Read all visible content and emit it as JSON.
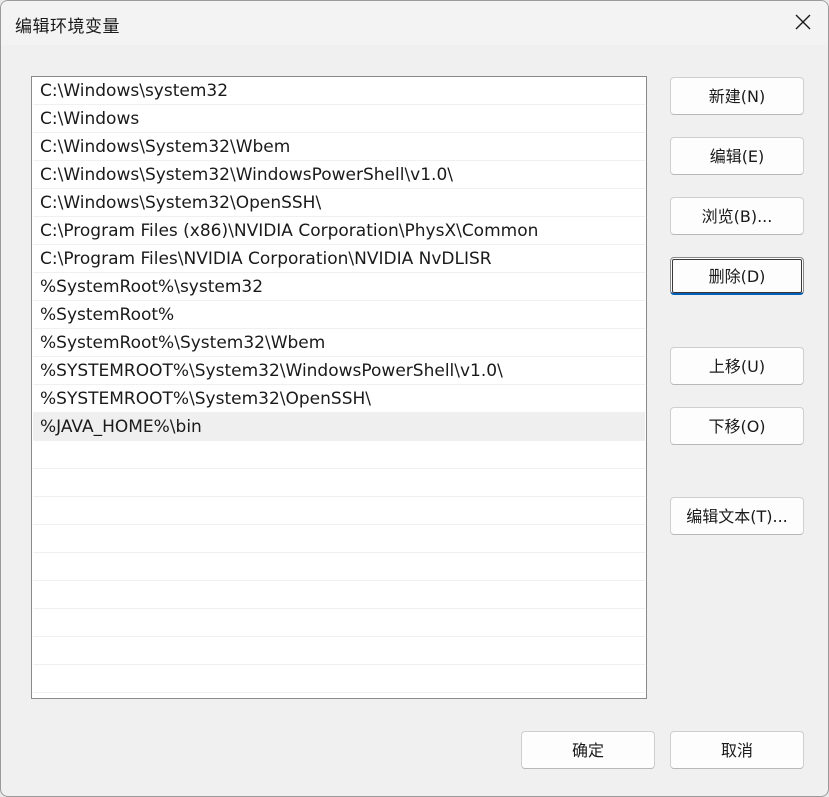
{
  "window": {
    "title": "编辑环境变量"
  },
  "path_list": {
    "items": [
      {
        "label": "C:\\Windows\\system32"
      },
      {
        "label": "C:\\Windows"
      },
      {
        "label": "C:\\Windows\\System32\\Wbem"
      },
      {
        "label": "C:\\Windows\\System32\\WindowsPowerShell\\v1.0\\"
      },
      {
        "label": "C:\\Windows\\System32\\OpenSSH\\"
      },
      {
        "label": "C:\\Program Files (x86)\\NVIDIA Corporation\\PhysX\\Common"
      },
      {
        "label": "C:\\Program Files\\NVIDIA Corporation\\NVIDIA NvDLISR"
      },
      {
        "label": "%SystemRoot%\\system32"
      },
      {
        "label": "%SystemRoot%"
      },
      {
        "label": "%SystemRoot%\\System32\\Wbem"
      },
      {
        "label": "%SYSTEMROOT%\\System32\\WindowsPowerShell\\v1.0\\"
      },
      {
        "label": "%SYSTEMROOT%\\System32\\OpenSSH\\"
      },
      {
        "label": "%JAVA_HOME%\\bin"
      }
    ],
    "selected_index": 12,
    "empty_rows": 9
  },
  "buttons": {
    "new": "新建(N)",
    "edit": "编辑(E)",
    "browse": "浏览(B)...",
    "delete": "删除(D)",
    "move_up": "上移(U)",
    "move_down": "下移(O)",
    "edit_text": "编辑文本(T)...",
    "ok": "确定",
    "cancel": "取消"
  },
  "colors": {
    "accent": "#005fb8",
    "dialog_bg": "#f0f0f0",
    "list_bg": "#ffffff",
    "selected_row": "#efefef"
  }
}
